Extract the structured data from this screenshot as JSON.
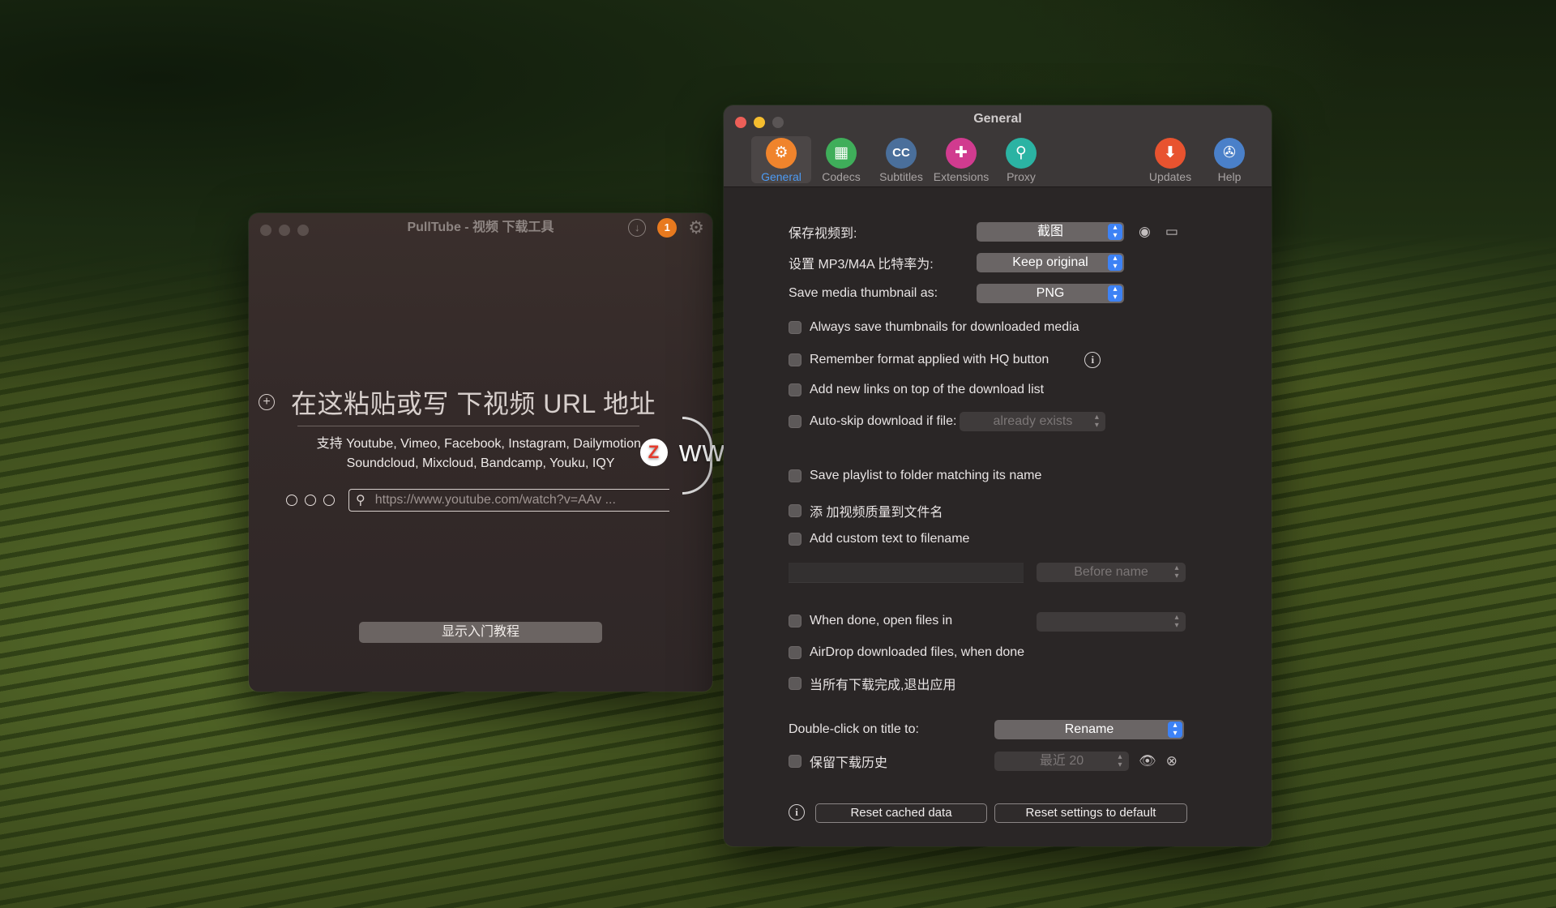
{
  "pulltube": {
    "title": "PullTube - 视频 下载工具",
    "badge_count": "1",
    "url_title": "在这粘贴或写 下视频 URL 地址",
    "support_line1": "支持 Youtube, Vimeo, Facebook, Instagram, Dailymotion,",
    "support_line2": "Soundcloud, Mixcloud, Bandcamp, Youku, IQY",
    "url_placeholder": "https://www.youtube.com/watch?v=AAv ...",
    "tutorial_label": "显示入门教程"
  },
  "watermark": {
    "logo_letter": "Z",
    "text": "www.MacZ.com"
  },
  "prefs": {
    "window_title": "General",
    "tabs": [
      {
        "label": "General",
        "icon": "gear-icon",
        "color": "#f0842c",
        "glyph": "⚙"
      },
      {
        "label": "Codecs",
        "icon": "film-icon",
        "color": "#3fae5a",
        "glyph": "▦"
      },
      {
        "label": "Subtitles",
        "icon": "cc-icon",
        "color": "#4a6f9b",
        "glyph": "CC"
      },
      {
        "label": "Extensions",
        "icon": "puzzle-icon",
        "color": "#d13b8f",
        "glyph": "✚"
      },
      {
        "label": "Proxy",
        "icon": "key-icon",
        "color": "#2bb3a3",
        "glyph": "⚲"
      },
      {
        "label": "Updates",
        "icon": "download-arrow-icon",
        "color": "#e8532f",
        "glyph": "⬇"
      },
      {
        "label": "Help",
        "icon": "lifebuoy-icon",
        "color": "#4a80c9",
        "glyph": "✇"
      }
    ],
    "save_video_label": "保存视频到:",
    "save_video_value": "截图",
    "bitrate_label": "设置 MP3/M4A 比特率为:",
    "bitrate_value": "Keep original",
    "thumb_label": "Save media thumbnail as:",
    "thumb_value": "PNG",
    "opt_always_thumbs": "Always save thumbnails for downloaded media",
    "opt_remember_hq": "Remember format applied with HQ button",
    "opt_add_top": "Add new links on top of the download list",
    "opt_autoskip": "Auto-skip download if file:",
    "autoskip_value": "already exists",
    "opt_playlist_folder": "Save playlist to folder matching its name",
    "opt_add_quality": "添 加视频质量到文件名",
    "opt_custom_text": "Add custom text to filename",
    "custom_text_position": "Before name",
    "opt_open_files": "When done, open files in",
    "open_files_value": "",
    "opt_airdrop": "AirDrop downloaded files, when done",
    "opt_quit": "当所有下载完成,退出应用",
    "dblclick_label": "Double-click on title to:",
    "dblclick_value": "Rename",
    "opt_history": "保留下载历史",
    "history_value": "最近 20",
    "reset_cache": "Reset cached data",
    "reset_settings": "Reset settings to default"
  },
  "colors": {
    "accent": "#3d82f5",
    "close": "#ed5f58",
    "minimize": "#f5bd2e",
    "zoom_inactive": "#5a5555"
  }
}
